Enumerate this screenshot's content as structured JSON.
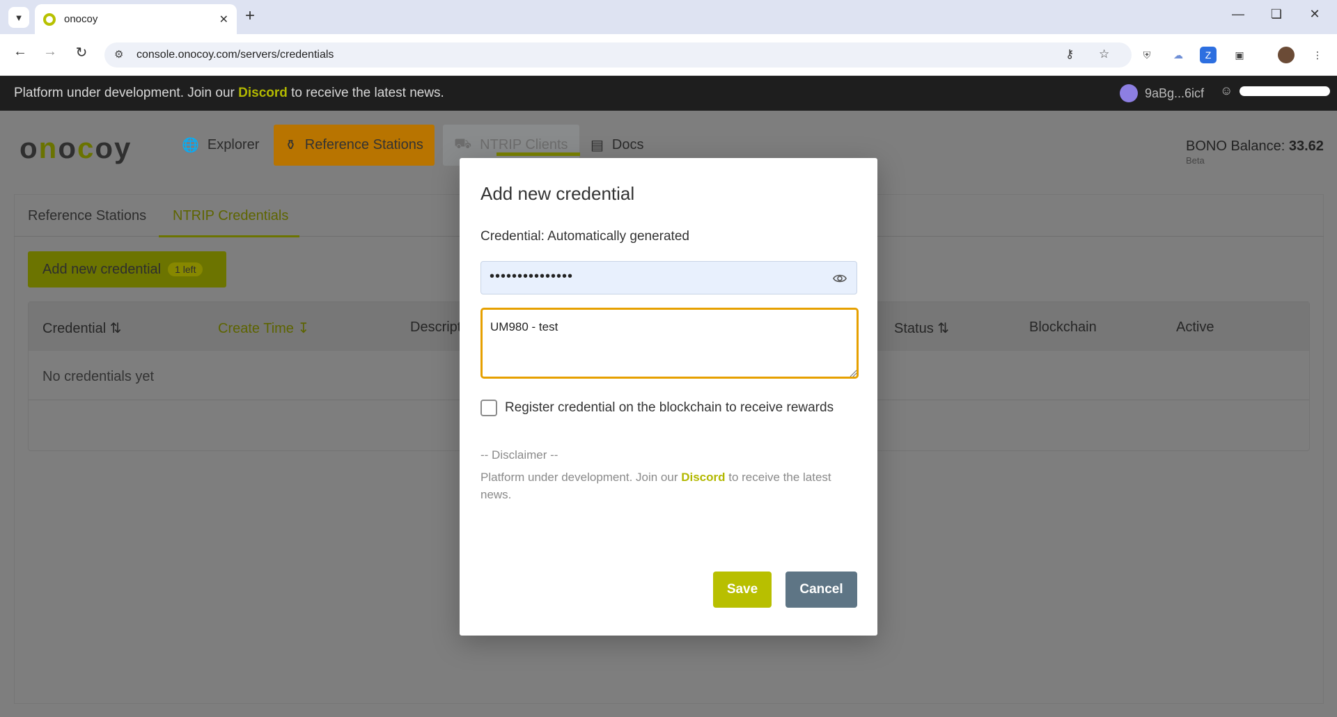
{
  "browser": {
    "tab_title": "onocoy",
    "url": "console.onocoy.com/servers/credentials"
  },
  "announcement": {
    "prefix": "Platform under development. Join our ",
    "link": "Discord",
    "suffix": " to receive the latest news."
  },
  "account": {
    "wallet": "9aBg...6icf"
  },
  "header": {
    "nav": [
      "Explorer",
      "Reference Stations",
      "NTRIP Clients",
      "Docs"
    ],
    "balance_label": "BONO Balance:",
    "balance_value": "33.62",
    "beta": "Beta"
  },
  "page": {
    "tabs": [
      "Reference Stations",
      "NTRIP Credentials"
    ],
    "add_button": "Add new credential",
    "add_badge": "1 left",
    "table": {
      "columns": [
        "Credential",
        "Create Time",
        "Descript",
        "Status",
        "Blockchain",
        "Active"
      ],
      "empty_text": "No credentials yet"
    }
  },
  "modal": {
    "title": "Add new credential",
    "credential_label": "Credential: Automatically generated",
    "password_mask": "•••••••••••••••",
    "description_value": "UM980 - test",
    "checkbox_label": "Register credential on the blockchain to receive rewards",
    "checkbox_checked": false,
    "disclaimer_head": "-- Disclaimer --",
    "disclaimer_prefix": "Platform under development. Join our ",
    "disclaimer_link": "Discord",
    "disclaimer_suffix": " to receive the latest news.",
    "save_label": "Save",
    "cancel_label": "Cancel"
  },
  "colors": {
    "accent": "#b8bf00",
    "focus": "#e6a000",
    "cancel": "#5e7585"
  }
}
